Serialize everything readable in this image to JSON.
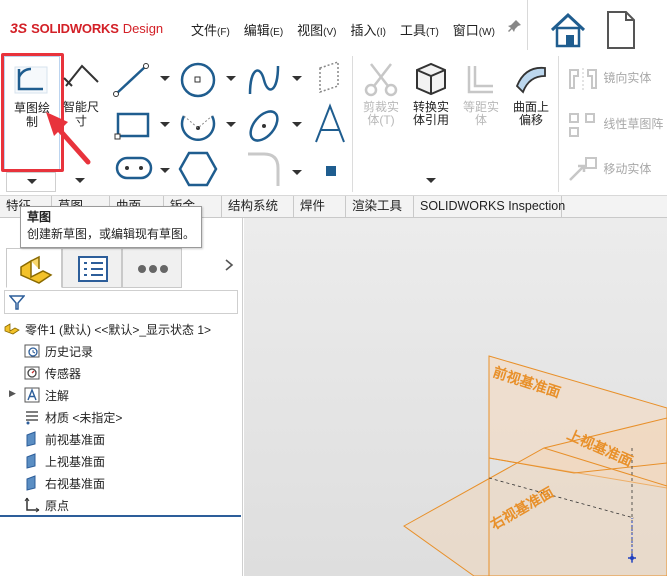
{
  "app": {
    "logo_ds": "3S",
    "logo_brand": "SOLIDWORKS",
    "logo_suffix": "Design"
  },
  "menu": [
    {
      "label": "文件",
      "key": "(F)"
    },
    {
      "label": "编辑",
      "key": "(E)"
    },
    {
      "label": "视图",
      "key": "(V)"
    },
    {
      "label": "插入",
      "key": "(I)"
    },
    {
      "label": "工具",
      "key": "(T)"
    },
    {
      "label": "窗口",
      "key": "(W)"
    }
  ],
  "ribbon": {
    "sketch_label_1": "草图绘",
    "sketch_label_2": "制",
    "smart_dim_label_1": "智能尺",
    "smart_dim_label_2": "寸",
    "trim_label_1": "剪裁实",
    "trim_label_2": "体(T)",
    "convert_label_1": "转换实",
    "convert_label_2": "体引用",
    "offset_label_1": "等距实",
    "offset_label_2": "体",
    "surface_offset_label_1": "曲面上",
    "surface_offset_label_2": "偏移",
    "mirror_label": "镜向实体",
    "pattern_label": "线性草图阵",
    "move_label": "移动实体"
  },
  "tabs": [
    "特征",
    "草图",
    "曲面",
    "钣金",
    "结构系统",
    "焊件",
    "渲染工具",
    "SOLIDWORKS Inspection"
  ],
  "tooltip": {
    "title": "草图",
    "description": "创建新草图，或编辑现有草图。"
  },
  "tree": {
    "root": "零件1 (默认) <<默认>_显示状态 1>",
    "items": [
      "历史记录",
      "传感器",
      "注解",
      "材质 <未指定>",
      "前视基准面",
      "上视基准面",
      "右视基准面",
      "原点"
    ]
  },
  "viewport": {
    "front_plane": "前视基准面",
    "top_plane": "上视基准面",
    "right_plane": "右视基准面",
    "plane_color": "#e8902a"
  },
  "colors": {
    "accent_red": "#e8333c",
    "brand_red": "#d32027",
    "tree_blue": "#2d5e9a"
  }
}
